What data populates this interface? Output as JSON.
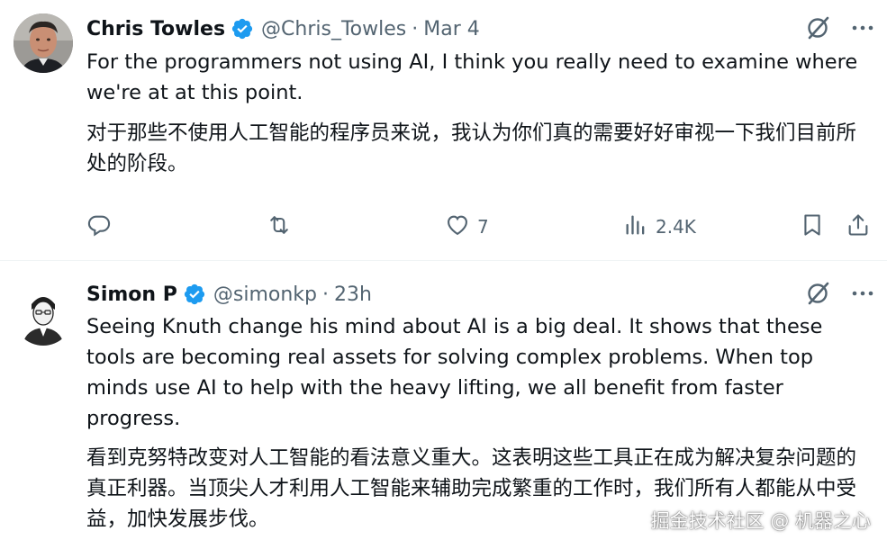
{
  "colors": {
    "text": "#0f1419",
    "muted": "#536471",
    "verified": "#1d9bf0",
    "divider": "#eff3f4"
  },
  "tweets": [
    {
      "name": "Chris Towles",
      "handle": "@Chris_Towles",
      "dot": "·",
      "time": "Mar 4",
      "text_en": "For the programmers not using AI, I think you really need to examine where we're at at this point.",
      "text_zh": "对于那些不使用人工智能的程序员来说，我认为你们真的需要好好审视一下我们目前所处的阶段。",
      "actions": {
        "replies": "",
        "reposts": "",
        "likes": "7",
        "views": "2.4K"
      },
      "icons": [
        "grok-icon",
        "more-icon",
        "reply-icon",
        "repost-icon",
        "like-icon",
        "views-icon",
        "bookmark-icon",
        "share-icon"
      ]
    },
    {
      "name": "Simon P",
      "handle": "@simonkp",
      "dot": "·",
      "time": "23h",
      "text_en": "Seeing Knuth change his mind about AI is a big deal. It shows that these tools are becoming real assets for solving complex problems. When top minds use AI to help with the heavy lifting, we all benefit from faster progress.",
      "text_zh": "看到克努特改变对人工智能的看法意义重大。这表明这些工具正在成为解决复杂问题的真正利器。当顶尖人才利用人工智能来辅助完成繁重的工作时，我们所有人都能从中受益，加快发展步伐。"
    }
  ],
  "watermark": {
    "text": "掘金技术社区 @ 机器之心"
  }
}
